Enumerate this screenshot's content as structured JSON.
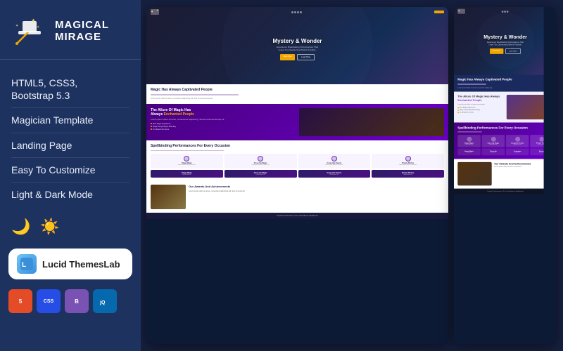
{
  "brand": {
    "name_top": "MAGICAL",
    "name_bottom": "MIRAGE"
  },
  "features": [
    {
      "text": "HTML5, CSS3, Bootstrap 5.3"
    },
    {
      "text": "Magician Template"
    },
    {
      "text": "Landing Page"
    },
    {
      "text": "Easy To Customize"
    },
    {
      "text": "Light & Dark Mode"
    }
  ],
  "lucid": {
    "badge_text": "Lucid ThemesLab"
  },
  "tech_badges": [
    {
      "label": "HTML5",
      "class": "badge-html"
    },
    {
      "label": "CSS3",
      "class": "badge-css"
    },
    {
      "label": "BS5",
      "class": "badge-bs"
    },
    {
      "label": "jQuery",
      "class": "badge-jq"
    }
  ],
  "preview": {
    "hero_title": "Mystery & Wonder",
    "hero_sub": "Experience Breathtaking Performances That\nLeave You Questioning What's Possible.",
    "btn_primary": "Book Now",
    "btn_outline": "Learn More",
    "section1_title": "Magic Has Always Captivated People",
    "section2_title": "The Allure Of Magic Has Always Enchanted People",
    "list_items": [
      "Best Magic Experience",
      "Magic Storytelling & Branding",
      "Our Experince Gives"
    ],
    "section3_title": "Spellbinding Performances For Every Occasion",
    "cards": [
      {
        "title": "Stage Magic"
      },
      {
        "title": "Close-Up Magic"
      },
      {
        "title": "Corporate Events"
      },
      {
        "title": "Private Parties"
      }
    ],
    "awards_title": "Our Awards And Achievements",
    "footer_note": "Popular Performance: The Left Audience Spellbound"
  },
  "colors": {
    "accent": "#f0a500",
    "purple": "#6600cc",
    "dark_bg": "#1a2a4a",
    "panel_bg": "#1e3260"
  }
}
